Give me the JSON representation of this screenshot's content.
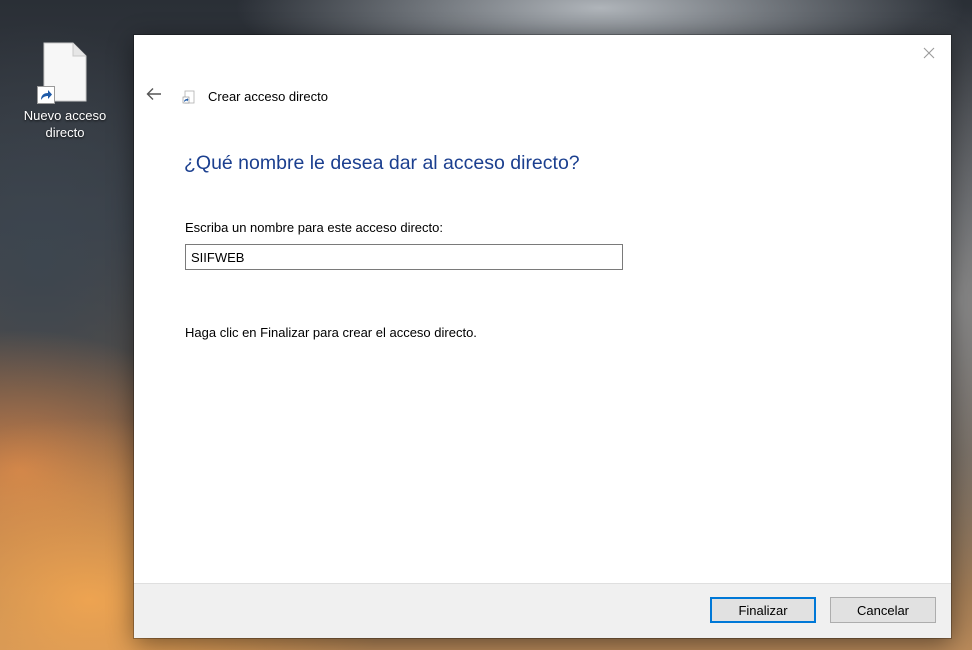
{
  "desktop": {
    "shortcut_icon": {
      "icon": "file-shortcut-icon",
      "label": "Nuevo acceso directo"
    }
  },
  "dialog": {
    "close_icon": "close-icon",
    "back_icon": "back-arrow-icon",
    "header_icon": "shortcut-small-icon",
    "title": "Crear acceso directo",
    "heading": "¿Qué nombre le desea dar al acceso directo?",
    "name_label": "Escriba un nombre para este acceso directo:",
    "name_value": "SIIFWEB",
    "instruction": "Haga clic en Finalizar para crear el acceso directo.",
    "buttons": {
      "finish": "Finalizar",
      "cancel": "Cancelar"
    }
  },
  "colors": {
    "heading": "#1b3f8f",
    "primary_border": "#0078d7",
    "footer_bg": "#f0f0f0"
  }
}
